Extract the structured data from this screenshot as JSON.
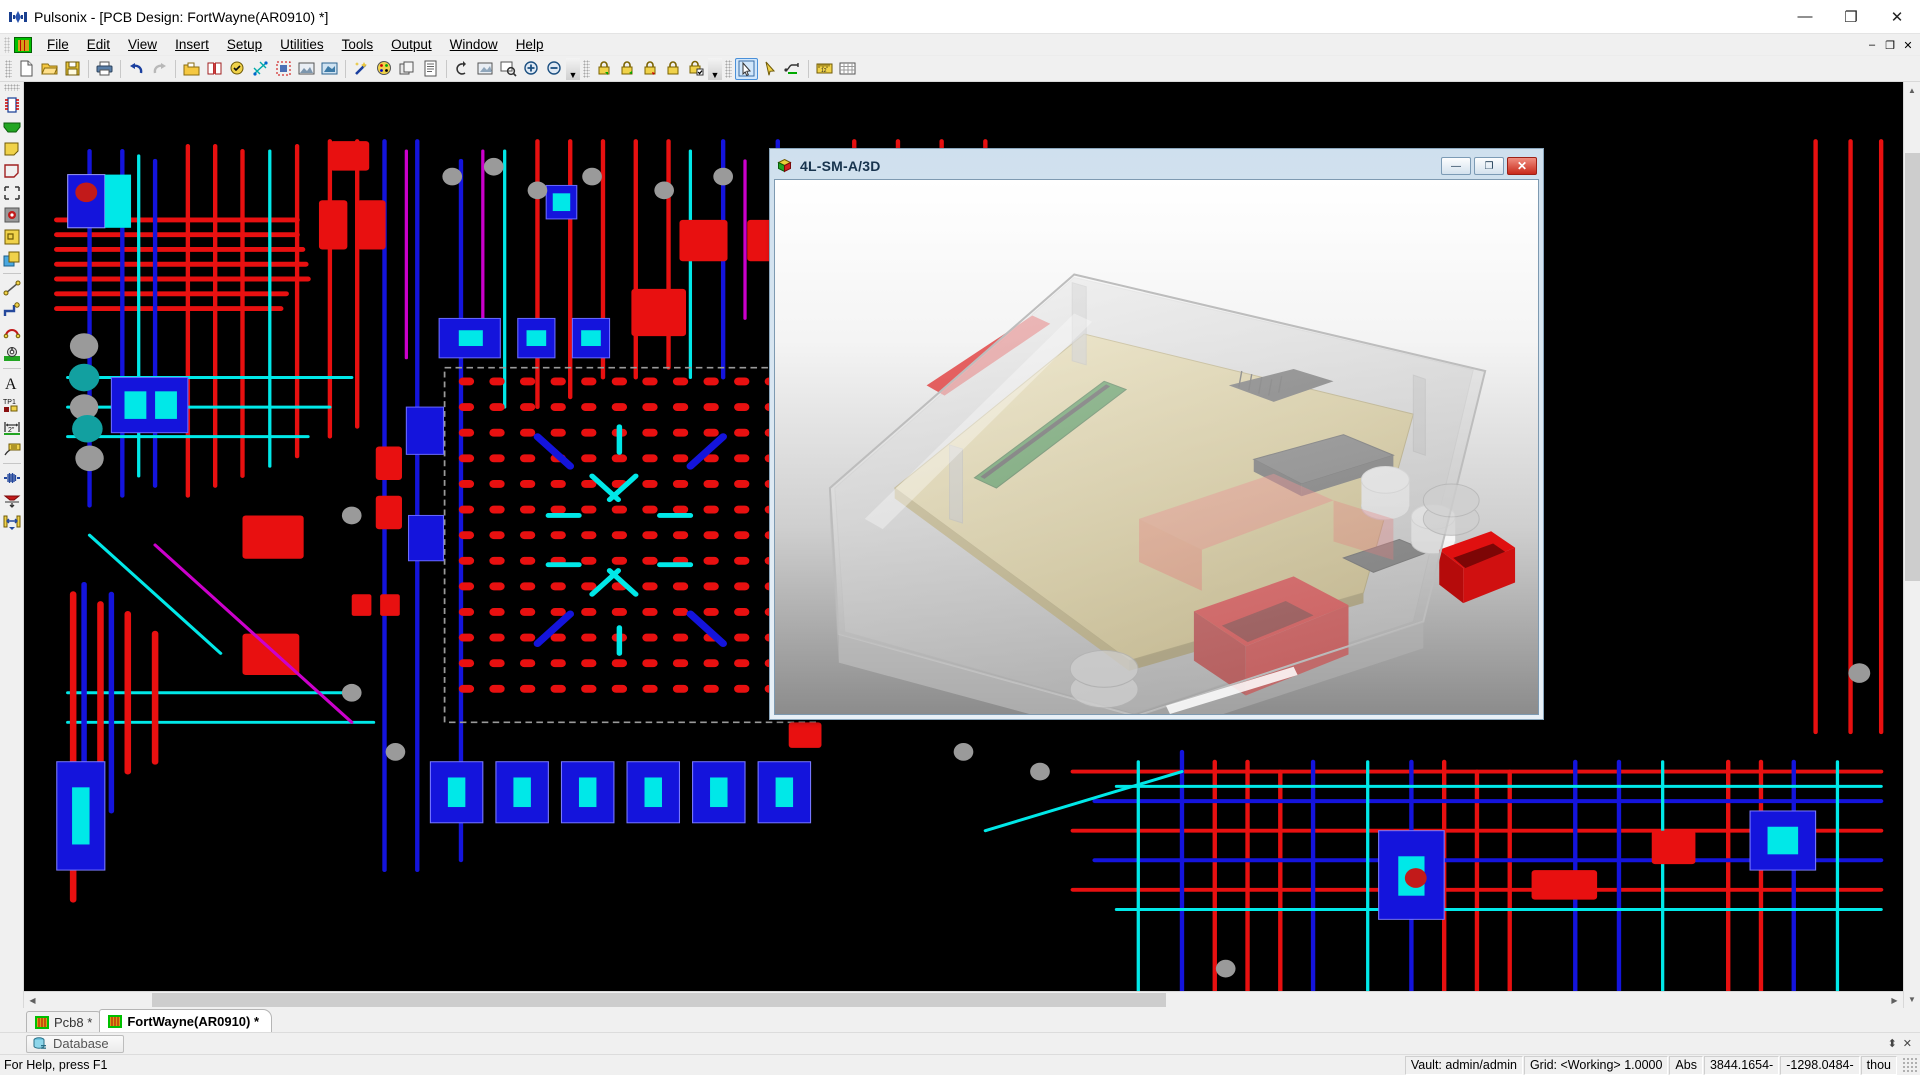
{
  "window": {
    "title": "Pulsonix - [PCB Design: FortWayne(AR0910) *]",
    "app_icon": "pulsonix-logo-icon",
    "minimize": "—",
    "restore": "❐",
    "close": "✕"
  },
  "menu": {
    "logo_icon": "pulsonix-menu-logo-icon",
    "items": [
      {
        "label": "File",
        "accel": "F"
      },
      {
        "label": "Edit",
        "accel": "E"
      },
      {
        "label": "View",
        "accel": "V"
      },
      {
        "label": "Insert",
        "accel": "I"
      },
      {
        "label": "Setup",
        "accel": "S"
      },
      {
        "label": "Utilities",
        "accel": "U"
      },
      {
        "label": "Tools",
        "accel": "T"
      },
      {
        "label": "Output",
        "accel": "O"
      },
      {
        "label": "Window",
        "accel": "W"
      },
      {
        "label": "Help",
        "accel": "H"
      }
    ],
    "mdi_minimize": "–",
    "mdi_restore": "❐",
    "mdi_close": "✕"
  },
  "toolbar": {
    "groups": [
      {
        "name": "standard",
        "buttons": [
          {
            "icon": "new-document-icon",
            "label": "New"
          },
          {
            "icon": "open-folder-icon",
            "label": "Open"
          },
          {
            "icon": "save-disk-icon",
            "label": "Save"
          },
          {
            "icon": "print-icon",
            "label": "Print"
          },
          {
            "icon": "undo-arrow-icon",
            "label": "Undo"
          },
          {
            "icon": "redo-arrow-icon",
            "label": "Redo"
          },
          {
            "icon": "open-library-icon",
            "label": "Libraries"
          },
          {
            "icon": "book-icon",
            "label": "Technology"
          },
          {
            "icon": "design-rules-icon",
            "label": "Design Rule Check"
          },
          {
            "icon": "net-icon",
            "label": "Nets"
          },
          {
            "icon": "layers-icon",
            "label": "Layers"
          },
          {
            "icon": "photo-icon",
            "label": "Preview"
          },
          {
            "icon": "3d-view-icon",
            "label": "3D View"
          },
          {
            "icon": "wand-icon",
            "label": "Auto Route"
          },
          {
            "icon": "colour-palette-icon",
            "label": "Colours"
          },
          {
            "icon": "layer-stack-icon",
            "label": "Layer Stack"
          },
          {
            "icon": "report-icon",
            "label": "Reports"
          },
          {
            "icon": "panning-hand-icon",
            "label": "Pan"
          },
          {
            "icon": "zoom-window-icon",
            "label": "Zoom Window"
          },
          {
            "icon": "zoom-selection-icon",
            "label": "Zoom Selection"
          },
          {
            "icon": "zoom-in-icon",
            "label": "Zoom In"
          },
          {
            "icon": "zoom-out-icon",
            "label": "Zoom Out"
          }
        ]
      },
      {
        "name": "locks",
        "buttons": [
          {
            "icon": "lock-green-icon",
            "label": "Lock Tracks"
          },
          {
            "icon": "lock-yellow-icon",
            "label": "Lock Vias"
          },
          {
            "icon": "lock-red-icon",
            "label": "Lock Components"
          },
          {
            "icon": "lock-plain-icon",
            "label": "Lock All"
          },
          {
            "icon": "lock-check-icon",
            "label": "Lock Settings"
          }
        ]
      },
      {
        "name": "edit-tools",
        "buttons": [
          {
            "icon": "select-arrow-icon",
            "label": "Select",
            "active": true
          },
          {
            "icon": "pointer-yellow-icon",
            "label": "Pick"
          },
          {
            "icon": "measure-net-icon",
            "label": "Net Probe"
          },
          {
            "icon": "ruler-icon",
            "label": "Measure"
          },
          {
            "icon": "grid-icon",
            "label": "Grid"
          }
        ]
      }
    ]
  },
  "side_toolbar": {
    "buttons": [
      {
        "icon": "insert-component-icon",
        "label": "Insert Component"
      },
      {
        "icon": "insert-copper-area-icon",
        "label": "Insert Copper Area"
      },
      {
        "icon": "insert-shape-icon",
        "label": "Insert Shape"
      },
      {
        "icon": "insert-board-outline-icon",
        "label": "Insert Board Outline"
      },
      {
        "icon": "insert-area-icon",
        "label": "Insert Area"
      },
      {
        "icon": "insert-pad-icon",
        "label": "Insert Pad"
      },
      {
        "icon": "insert-copper-icon",
        "label": "Insert Copper"
      },
      {
        "icon": "insert-plane-icon",
        "label": "Insert Plane"
      },
      {
        "icon": "insert-line-icon",
        "label": "Insert Line"
      },
      {
        "icon": "insert-track-icon",
        "label": "Insert Track"
      },
      {
        "icon": "insert-arc-icon",
        "label": "Insert Arc"
      },
      {
        "icon": "insert-via-icon",
        "label": "Insert Via"
      },
      {
        "icon": "insert-text-icon",
        "label": "Insert Text"
      },
      {
        "icon": "insert-testpoint-icon",
        "label": "Insert Test Point"
      },
      {
        "icon": "insert-dimension-icon",
        "label": "Insert Dimension"
      },
      {
        "icon": "insert-callout-icon",
        "label": "Insert Callout"
      },
      {
        "icon": "insert-teardrop-icon",
        "label": "Insert Teardrop"
      },
      {
        "icon": "insert-mitre-icon",
        "label": "Insert Mitre"
      },
      {
        "icon": "insert-necking-icon",
        "label": "Insert Necking"
      }
    ]
  },
  "view3d": {
    "title": "4L-SM-A/3D",
    "icon": "3d-cube-icon",
    "minimize": "—",
    "maximize": "❐",
    "close": "✕"
  },
  "document_tabs": [
    {
      "label": "Pcb8 *",
      "icon": "pcb-doc-icon",
      "active": false
    },
    {
      "label": "FortWayne(AR0910) *",
      "icon": "pcb-doc-icon",
      "active": true
    }
  ],
  "panel_bar": {
    "database_label": "Database",
    "database_icon": "database-icon",
    "pin_icon": "⬍",
    "close_icon": "✕"
  },
  "statusbar": {
    "help_text": "For Help, press F1",
    "cells": [
      "Vault: admin/admin",
      "Grid: <Working> 1.0000",
      "Abs",
      "3844.1654-",
      "-1298.0484-",
      "thou"
    ]
  },
  "colors": {
    "track_red": "#e81010",
    "track_blue": "#1414dc",
    "track_cyan": "#00e8e8",
    "track_magenta": "#cc00cc",
    "pad_grey": "#9a9a9a",
    "board_black": "#000000",
    "accent_blue": "#4a90d9",
    "close_red": "#c8291a"
  }
}
